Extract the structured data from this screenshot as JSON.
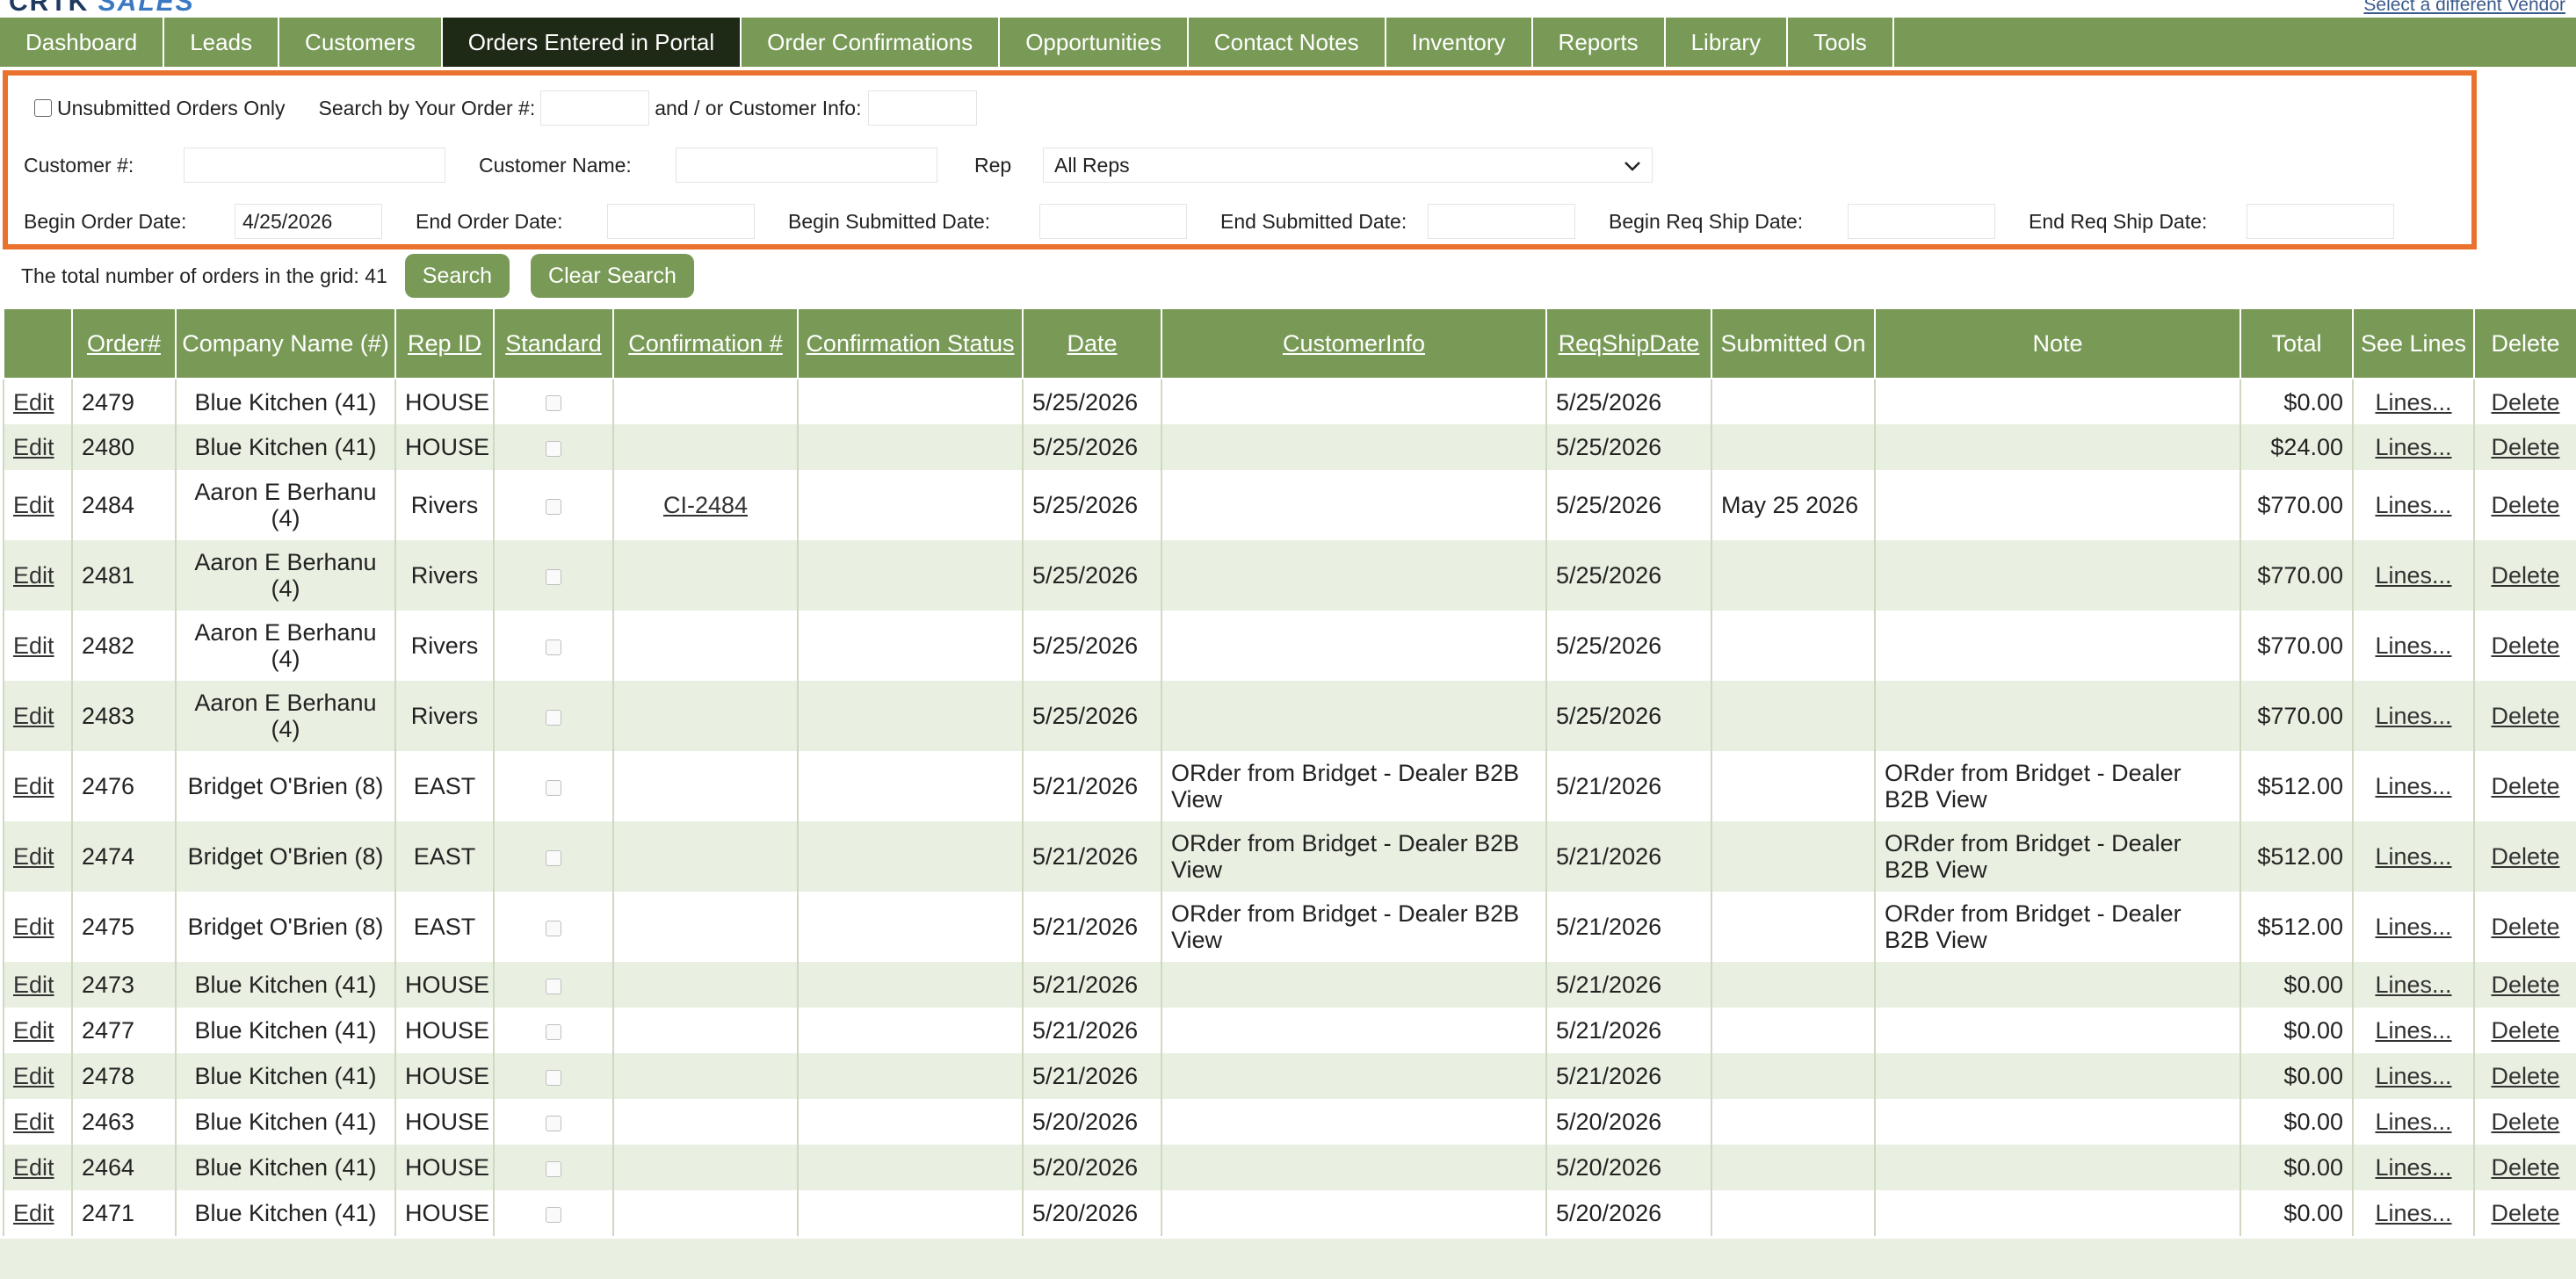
{
  "brand": {
    "part1": "CRTK",
    "part2": "SALES"
  },
  "vendor_link": "Select a different Vendor",
  "nav": [
    {
      "label": "Dashboard",
      "active": false
    },
    {
      "label": "Leads",
      "active": false
    },
    {
      "label": "Customers",
      "active": false
    },
    {
      "label": "Orders Entered in Portal",
      "active": true
    },
    {
      "label": "Order Confirmations",
      "active": false
    },
    {
      "label": "Opportunities",
      "active": false
    },
    {
      "label": "Contact Notes",
      "active": false
    },
    {
      "label": "Inventory",
      "active": false
    },
    {
      "label": "Reports",
      "active": false
    },
    {
      "label": "Library",
      "active": false
    },
    {
      "label": "Tools",
      "active": false
    }
  ],
  "filters": {
    "unsubmitted_label": "Unsubmitted Orders Only",
    "unsubmitted_checked": false,
    "order_num_label": "Search by Your Order #:",
    "order_num_value": "",
    "customer_info_label": "and / or Customer Info:",
    "customer_info_value": "",
    "customer_num_label": "Customer #:",
    "customer_num_value": "",
    "customer_name_label": "Customer Name:",
    "customer_name_value": "",
    "rep_label": "Rep",
    "rep_value": "All Reps",
    "begin_order_label": "Begin Order Date:",
    "begin_order_value": "4/25/2026",
    "end_order_label": "End Order Date:",
    "end_order_value": "",
    "begin_submitted_label": "Begin Submitted Date:",
    "begin_submitted_value": "",
    "end_submitted_label": "End Submitted Date:",
    "end_submitted_value": "",
    "begin_req_label": "Begin Req Ship Date:",
    "begin_req_value": "",
    "end_req_label": "End Req Ship Date:",
    "end_req_value": ""
  },
  "actions": {
    "total_text": "The total number of orders in the grid: 41",
    "search_label": "Search",
    "clear_label": "Clear Search"
  },
  "grid": {
    "columns": [
      "",
      "Order#",
      "Company Name (#)",
      "Rep ID",
      "Standard",
      "Confirmation #",
      "Confirmation Status",
      "Date",
      "CustomerInfo",
      "ReqShipDate",
      "Submitted On",
      "Note",
      "Total",
      "See Lines",
      "Delete"
    ],
    "edit_label": "Edit",
    "lines_label": "Lines...",
    "delete_label": "Delete",
    "rows": [
      {
        "order": "2479",
        "company": "Blue Kitchen (41)",
        "rep": "HOUSE",
        "confirmation": "",
        "status": "",
        "date": "5/25/2026",
        "customer_info": "",
        "req_ship": "5/25/2026",
        "submitted": "",
        "note": "",
        "total": "$0.00"
      },
      {
        "order": "2480",
        "company": "Blue Kitchen (41)",
        "rep": "HOUSE",
        "confirmation": "",
        "status": "",
        "date": "5/25/2026",
        "customer_info": "",
        "req_ship": "5/25/2026",
        "submitted": "",
        "note": "",
        "total": "$24.00"
      },
      {
        "order": "2484",
        "company": "Aaron E Berhanu (4)",
        "rep": "Rivers",
        "confirmation": "CI-2484",
        "status": "",
        "date": "5/25/2026",
        "customer_info": "",
        "req_ship": "5/25/2026",
        "submitted": "May 25 2026",
        "note": "",
        "total": "$770.00"
      },
      {
        "order": "2481",
        "company": "Aaron E Berhanu (4)",
        "rep": "Rivers",
        "confirmation": "",
        "status": "",
        "date": "5/25/2026",
        "customer_info": "",
        "req_ship": "5/25/2026",
        "submitted": "",
        "note": "",
        "total": "$770.00"
      },
      {
        "order": "2482",
        "company": "Aaron E Berhanu (4)",
        "rep": "Rivers",
        "confirmation": "",
        "status": "",
        "date": "5/25/2026",
        "customer_info": "",
        "req_ship": "5/25/2026",
        "submitted": "",
        "note": "",
        "total": "$770.00"
      },
      {
        "order": "2483",
        "company": "Aaron E Berhanu (4)",
        "rep": "Rivers",
        "confirmation": "",
        "status": "",
        "date": "5/25/2026",
        "customer_info": "",
        "req_ship": "5/25/2026",
        "submitted": "",
        "note": "",
        "total": "$770.00"
      },
      {
        "order": "2476",
        "company": "Bridget O'Brien (8)",
        "rep": "EAST",
        "confirmation": "",
        "status": "",
        "date": "5/21/2026",
        "customer_info": "ORder from Bridget - Dealer B2B View",
        "req_ship": "5/21/2026",
        "submitted": "",
        "note": "ORder from Bridget - Dealer B2B View",
        "total": "$512.00"
      },
      {
        "order": "2474",
        "company": "Bridget O'Brien (8)",
        "rep": "EAST",
        "confirmation": "",
        "status": "",
        "date": "5/21/2026",
        "customer_info": "ORder from Bridget - Dealer B2B View",
        "req_ship": "5/21/2026",
        "submitted": "",
        "note": "ORder from Bridget - Dealer B2B View",
        "total": "$512.00"
      },
      {
        "order": "2475",
        "company": "Bridget O'Brien (8)",
        "rep": "EAST",
        "confirmation": "",
        "status": "",
        "date": "5/21/2026",
        "customer_info": "ORder from Bridget - Dealer B2B View",
        "req_ship": "5/21/2026",
        "submitted": "",
        "note": "ORder from Bridget - Dealer B2B View",
        "total": "$512.00"
      },
      {
        "order": "2473",
        "company": "Blue Kitchen (41)",
        "rep": "HOUSE",
        "confirmation": "",
        "status": "",
        "date": "5/21/2026",
        "customer_info": "",
        "req_ship": "5/21/2026",
        "submitted": "",
        "note": "",
        "total": "$0.00"
      },
      {
        "order": "2477",
        "company": "Blue Kitchen (41)",
        "rep": "HOUSE",
        "confirmation": "",
        "status": "",
        "date": "5/21/2026",
        "customer_info": "",
        "req_ship": "5/21/2026",
        "submitted": "",
        "note": "",
        "total": "$0.00"
      },
      {
        "order": "2478",
        "company": "Blue Kitchen (41)",
        "rep": "HOUSE",
        "confirmation": "",
        "status": "",
        "date": "5/21/2026",
        "customer_info": "",
        "req_ship": "5/21/2026",
        "submitted": "",
        "note": "",
        "total": "$0.00"
      },
      {
        "order": "2463",
        "company": "Blue Kitchen (41)",
        "rep": "HOUSE",
        "confirmation": "",
        "status": "",
        "date": "5/20/2026",
        "customer_info": "",
        "req_ship": "5/20/2026",
        "submitted": "",
        "note": "",
        "total": "$0.00"
      },
      {
        "order": "2464",
        "company": "Blue Kitchen (41)",
        "rep": "HOUSE",
        "confirmation": "",
        "status": "",
        "date": "5/20/2026",
        "customer_info": "",
        "req_ship": "5/20/2026",
        "submitted": "",
        "note": "",
        "total": "$0.00"
      },
      {
        "order": "2471",
        "company": "Blue Kitchen (41)",
        "rep": "HOUSE",
        "confirmation": "",
        "status": "",
        "date": "5/20/2026",
        "customer_info": "",
        "req_ship": "5/20/2026",
        "submitted": "",
        "note": "",
        "total": "$0.00"
      }
    ]
  },
  "colors": {
    "nav_green": "#789a56",
    "nav_active": "#1f2a16",
    "panel_border": "#e9722e",
    "row_alt": "#e9f0e1"
  }
}
